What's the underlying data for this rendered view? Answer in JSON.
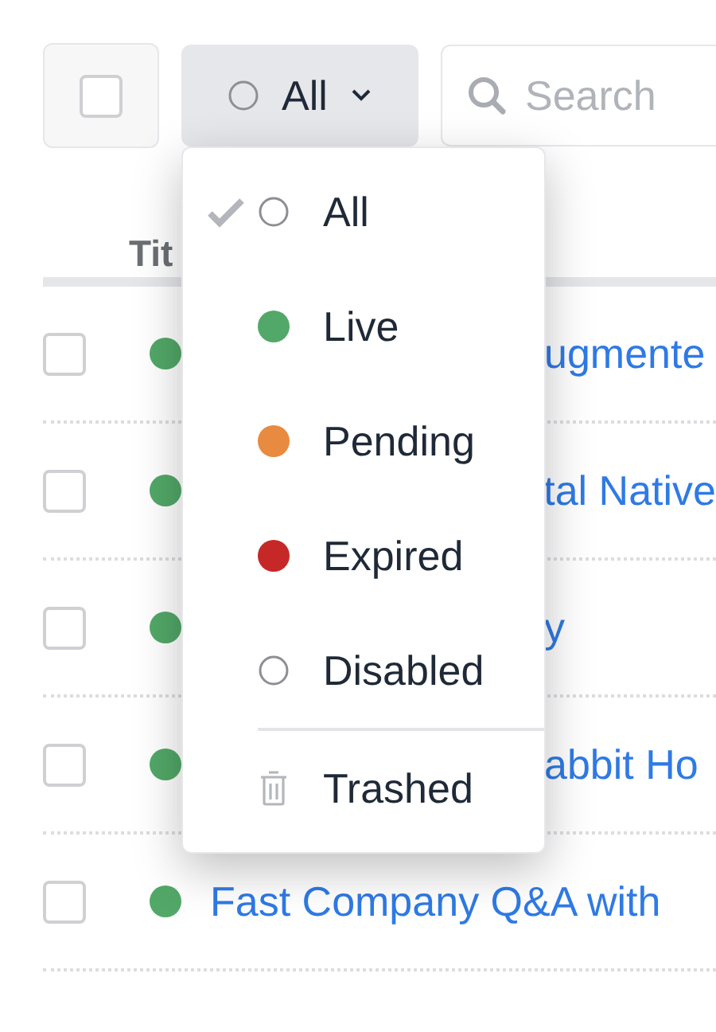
{
  "toolbar": {
    "select_all": {
      "checked": false
    },
    "filter": {
      "label": "All",
      "expanded": true
    },
    "search": {
      "placeholder": "Search"
    }
  },
  "table": {
    "columns": [
      "Tit"
    ],
    "rows": [
      {
        "checked": false,
        "color": "#52a868",
        "title": "ugmente"
      },
      {
        "checked": false,
        "color": "#52a868",
        "title": "tal Native"
      },
      {
        "checked": false,
        "color": "#52a868",
        "title": "y"
      },
      {
        "checked": false,
        "color": "#52a868",
        "title": "abbit Ho"
      },
      {
        "checked": false,
        "color": "#52a868",
        "title": "Fast Company Q&A with"
      }
    ]
  },
  "menu": {
    "items": [
      {
        "label": "All",
        "selected": true,
        "kind": "outline"
      },
      {
        "label": "Live",
        "selected": false,
        "kind": "dot",
        "color": "#52a868"
      },
      {
        "label": "Pending",
        "selected": false,
        "kind": "dot",
        "color": "#e88a3f"
      },
      {
        "label": "Expired",
        "selected": false,
        "kind": "dot",
        "color": "#c62828"
      },
      {
        "label": "Disabled",
        "selected": false,
        "kind": "outline"
      },
      {
        "label": "Trashed",
        "selected": false,
        "kind": "trash"
      }
    ]
  }
}
